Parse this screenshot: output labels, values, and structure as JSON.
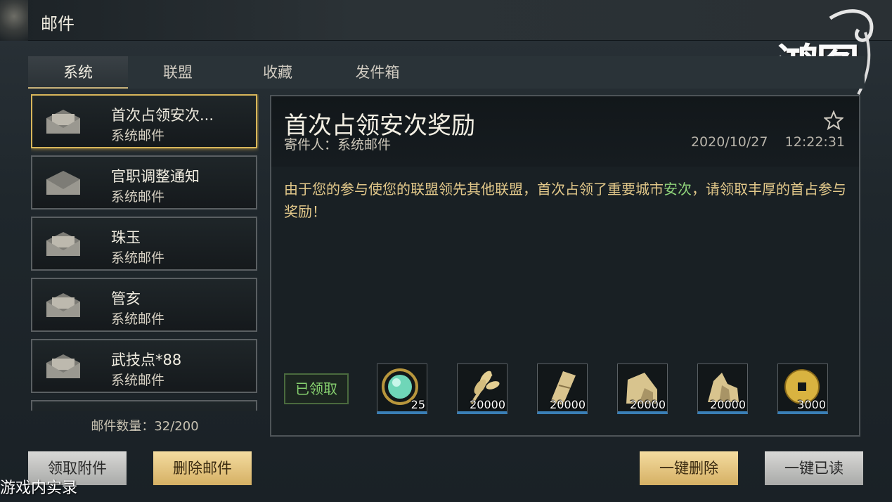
{
  "header": {
    "title": "邮件"
  },
  "logo": {
    "text": "鸿图"
  },
  "tabs": [
    {
      "label": "系统",
      "active": true
    },
    {
      "label": "联盟",
      "active": false
    },
    {
      "label": "收藏",
      "active": false
    },
    {
      "label": "发件箱",
      "active": false
    }
  ],
  "mails": [
    {
      "title": "首次占领安次...",
      "sender": "系统邮件",
      "selected": true,
      "icon": "envelope-open-icon"
    },
    {
      "title": "官职调整通知",
      "sender": "系统邮件",
      "selected": false,
      "icon": "envelope-open-icon"
    },
    {
      "title": "珠玉",
      "sender": "系统邮件",
      "selected": false,
      "icon": "envelope-open-icon"
    },
    {
      "title": "管亥",
      "sender": "系统邮件",
      "selected": false,
      "icon": "envelope-open-icon"
    },
    {
      "title": "武技点*88",
      "sender": "系统邮件",
      "selected": false,
      "icon": "envelope-open-icon"
    }
  ],
  "mail_count": "邮件数量：32/200",
  "detail": {
    "title": "首次占领安次奖励",
    "sender": "寄件人：系统邮件",
    "date": "2020/10/27",
    "time": "12:22:31",
    "body_before": "由于您的参与使您的联盟领先其他联盟，首次占领了重要城市",
    "body_highlight": "安次",
    "body_after": "，请领取丰厚的首占参与奖励！",
    "claimed_label": "已领取"
  },
  "rewards": [
    {
      "icon": "jade-orb-icon",
      "qty": "25"
    },
    {
      "icon": "wheat-icon",
      "qty": "20000"
    },
    {
      "icon": "wood-icon",
      "qty": "20000"
    },
    {
      "icon": "stone-icon",
      "qty": "20000"
    },
    {
      "icon": "iron-ore-icon",
      "qty": "20000"
    },
    {
      "icon": "copper-coin-icon",
      "qty": "3000"
    }
  ],
  "buttons": {
    "claim_attachments": "领取附件",
    "delete_mail": "删除邮件",
    "delete_all": "一键删除",
    "read_all": "一键已读"
  },
  "watermark": "游戏内实录",
  "colors": {
    "gold_accent": "#d8b65a",
    "highlight_green": "#8fd37a",
    "body_gold": "#e2c88a"
  }
}
